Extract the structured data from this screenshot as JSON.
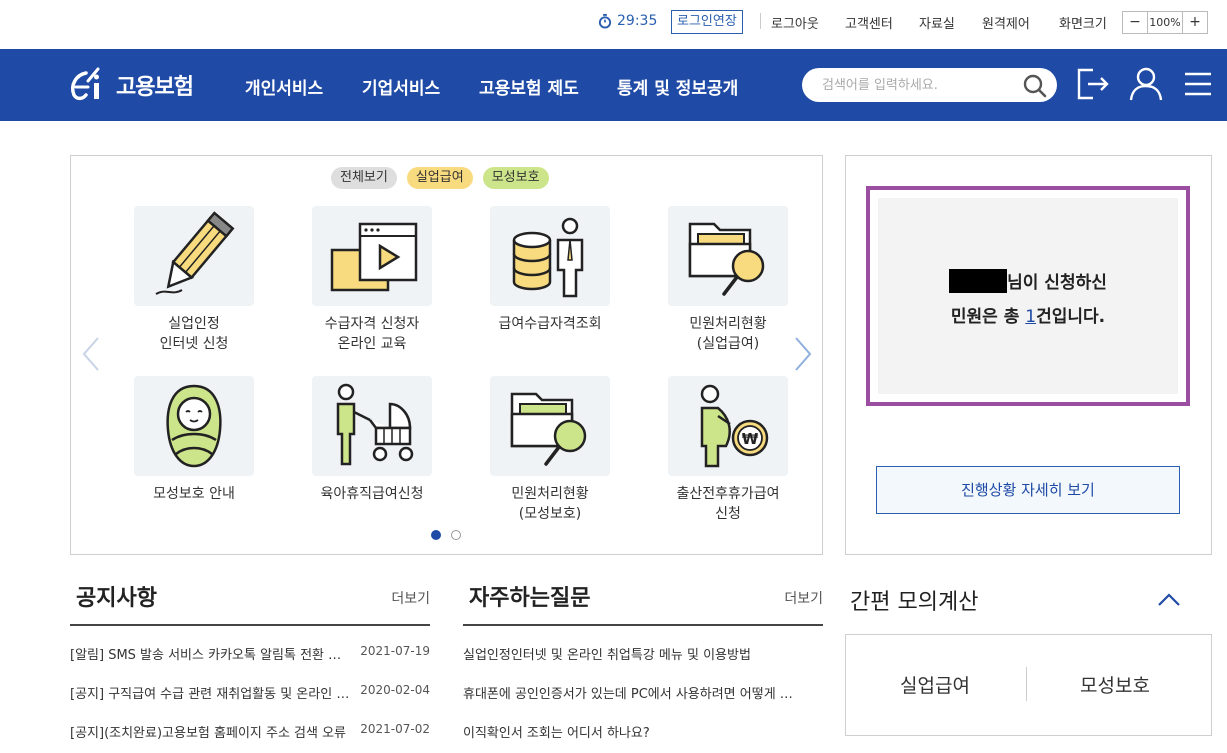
{
  "util": {
    "timer": "29:35",
    "extend_login": "로그인연장",
    "links": [
      "로그아웃",
      "고객센터",
      "자료실",
      "원격제어",
      "화면크기"
    ],
    "zoom_minus": "−",
    "zoom_value": "100%",
    "zoom_plus": "+"
  },
  "header": {
    "logo_text": "고용보험",
    "nav": [
      "개인서비스",
      "기업서비스",
      "고용보험 제도",
      "통계 및 정보공개"
    ],
    "search_placeholder": "검색어를 입력하세요."
  },
  "services": {
    "tags": [
      "전체보기",
      "실업급여",
      "모성보호"
    ],
    "cards": [
      {
        "label": "실업인정\n인터넷 신청",
        "icon": "pencil-icon"
      },
      {
        "label": "수급자격 신청자\n온라인 교육",
        "icon": "video-folder-icon"
      },
      {
        "label": "급여수급자격조회",
        "icon": "coins-person-icon"
      },
      {
        "label": "민원처리현황\n(실업급여)",
        "icon": "folder-search-icon"
      },
      {
        "label": "모성보호 안내",
        "icon": "baby-icon"
      },
      {
        "label": "육아휴직급여신청",
        "icon": "stroller-icon"
      },
      {
        "label": "민원처리현황\n(모성보호)",
        "icon": "folder-search-icon"
      },
      {
        "label": "출산전후휴가급여\n신청",
        "icon": "pregnant-won-icon"
      }
    ]
  },
  "application": {
    "line1_suffix": "님이 신청하신",
    "line2_prefix": "민원은 총 ",
    "count": "1",
    "line2_suffix": "건입니다.",
    "detail_button": "진행상황 자세히 보기"
  },
  "notice": {
    "title": "공지사항",
    "more": "더보기",
    "items": [
      {
        "title": "[알림] SMS 발송 서비스 카카오톡 알림톡 전환 안내",
        "date": "2021-07-19"
      },
      {
        "title": "[공지] 구직급여 수급 관련 재취업활동 및 온라인 교육",
        "date": "2020-02-04"
      },
      {
        "title": "[공지](조치완료)고용보험 홈페이지 주소 검색 오류",
        "date": "2021-07-02"
      }
    ]
  },
  "faq": {
    "title": "자주하는질문",
    "more": "더보기",
    "items": [
      {
        "title": "실업인정인터넷 및 온라인 취업특강 메뉴 및 이용방법"
      },
      {
        "title": "휴대폰에 공인인증서가 있는데 PC에서 사용하려면 어떻게 하나요?"
      },
      {
        "title": "이직확인서 조회는 어디서 하나요?"
      }
    ]
  },
  "calc": {
    "title": "간편 모의계산",
    "buttons": [
      "실업급여",
      "모성보호"
    ]
  },
  "colors": {
    "brand_blue": "#1f4aa5",
    "highlight_purple": "#9b4ea0",
    "tag_unemp": "#f8db7f",
    "tag_mat": "#cde58a"
  }
}
